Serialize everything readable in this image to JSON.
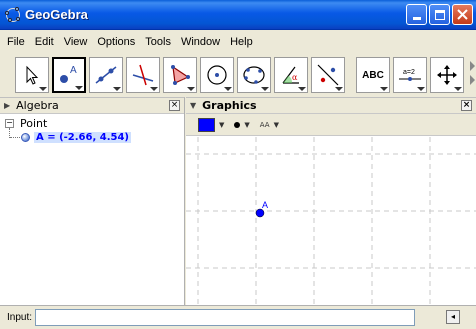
{
  "window": {
    "title": "GeoGebra"
  },
  "menu": [
    "File",
    "Edit",
    "View",
    "Options",
    "Tools",
    "Window",
    "Help"
  ],
  "toolbar": {
    "tools": [
      "move-tool",
      "new-point-tool",
      "line-through-two-points-tool",
      "perpendicular-line-tool",
      "polygon-tool",
      "circle-center-point-tool",
      "conic-through-five-points-tool",
      "angle-tool",
      "reflect-about-line-tool",
      "text-tool",
      "slider-tool",
      "move-graphics-view-tool"
    ],
    "selected": "new-point-tool",
    "text_label": "ABC",
    "slider_label": "a=2"
  },
  "algebra": {
    "title": "Algebra",
    "tree": {
      "category": "Point",
      "objects": [
        "A = (-2.66, 4.54)"
      ]
    }
  },
  "graphics": {
    "title": "Graphics",
    "style": {
      "color": "#0000ff",
      "label_style_text": "AA"
    },
    "points": [
      {
        "label": "A",
        "x": -2.66,
        "y": 4.54
      }
    ]
  },
  "input": {
    "label": "Input:",
    "value": ""
  },
  "colors": {
    "title_bar": "#0859e6",
    "point": "#0000ff",
    "selection": "#cfe0ff"
  }
}
